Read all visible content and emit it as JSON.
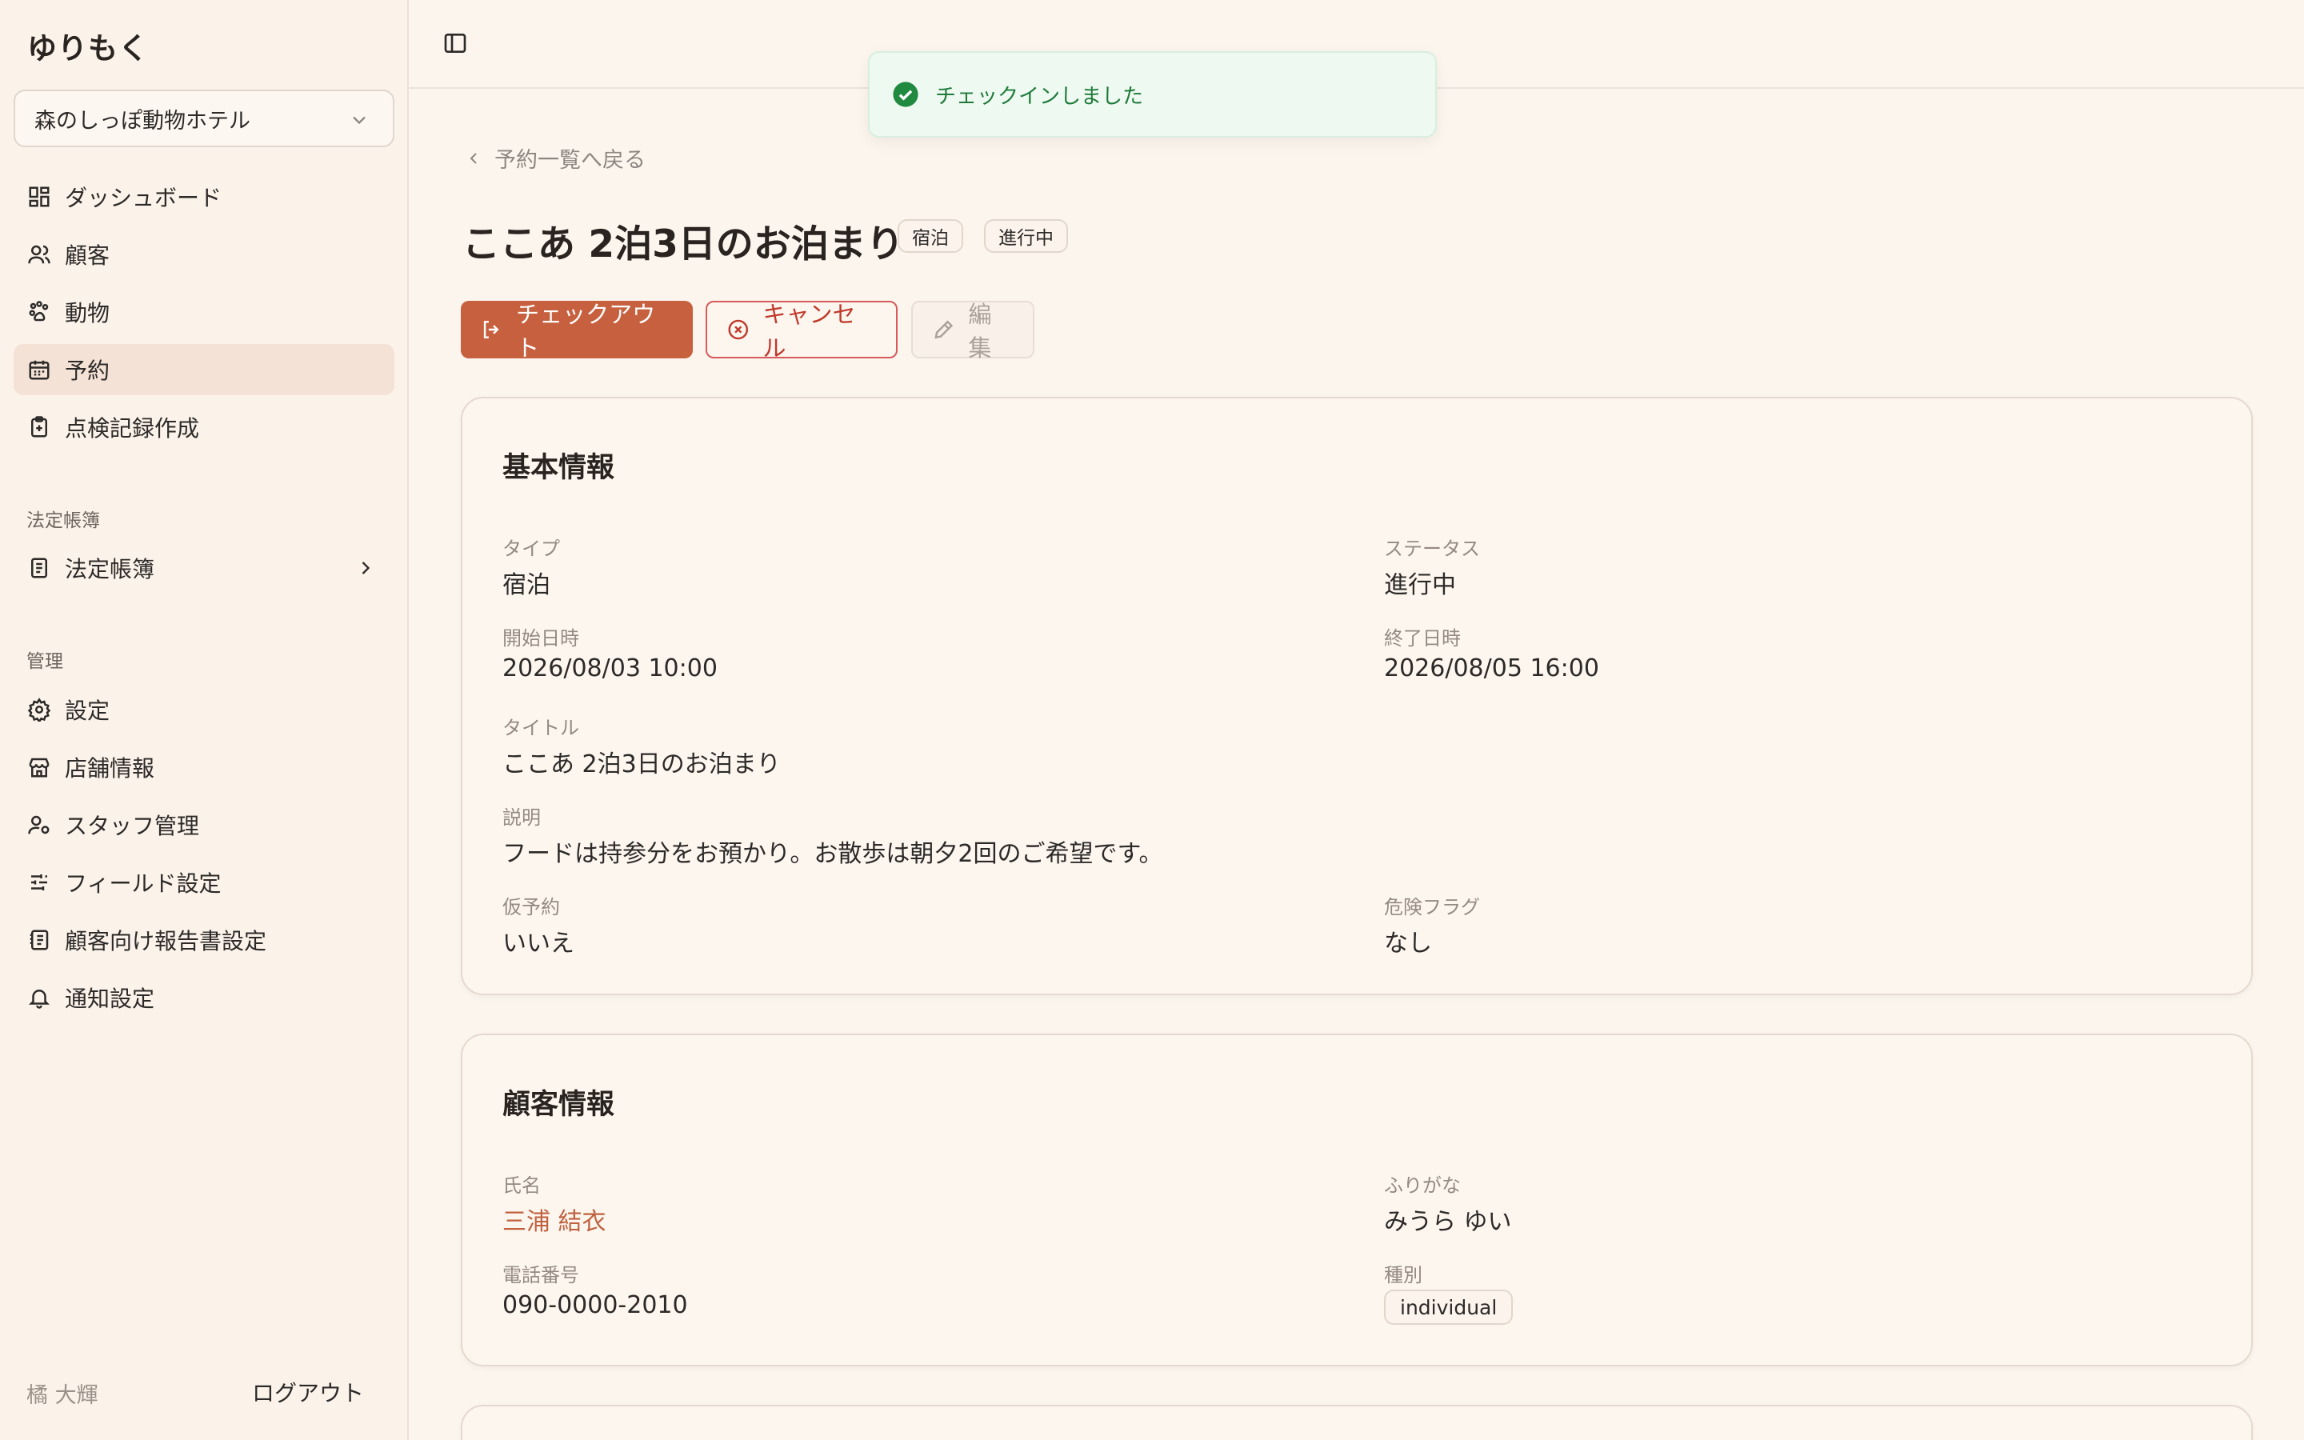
{
  "app": {
    "brand": "ゆりもく",
    "store": "森のしっぽ動物ホテル"
  },
  "sidebar": {
    "main_items": [
      {
        "label": "ダッシュボード",
        "icon": "dashboard-icon"
      },
      {
        "label": "顧客",
        "icon": "users-icon"
      },
      {
        "label": "動物",
        "icon": "paw-icon"
      },
      {
        "label": "予約",
        "icon": "calendar-icon",
        "active": true
      },
      {
        "label": "点検記録作成",
        "icon": "clipboard-icon"
      }
    ],
    "section_legal": "法定帳簿",
    "legal_items": [
      {
        "label": "法定帳簿",
        "icon": "book-icon"
      }
    ],
    "section_admin": "管理",
    "admin_items": [
      {
        "label": "設定",
        "icon": "gear-icon"
      },
      {
        "label": "店舗情報",
        "icon": "store-icon"
      },
      {
        "label": "スタッフ管理",
        "icon": "user-gear-icon"
      },
      {
        "label": "フィールド設定",
        "icon": "sliders-icon"
      },
      {
        "label": "顧客向け報告書設定",
        "icon": "report-icon"
      },
      {
        "label": "通知設定",
        "icon": "bell-icon"
      }
    ],
    "user_name": "橘 大輝",
    "logout": "ログアウト"
  },
  "toast": {
    "message": "チェックインしました"
  },
  "page": {
    "back_link": "予約一覧へ戻る",
    "title": "ここあ 2泊3日のお泊まり",
    "badges": [
      "宿泊",
      "進行中"
    ],
    "actions": {
      "checkout": "チェックアウト",
      "cancel": "キャンセル",
      "edit": "編集"
    }
  },
  "basic_info": {
    "title": "基本情報",
    "type_label": "タイプ",
    "type_value": "宿泊",
    "status_label": "ステータス",
    "status_value": "進行中",
    "start_label": "開始日時",
    "start_value": "2026/08/03 10:00",
    "end_label": "終了日時",
    "end_value": "2026/08/05 16:00",
    "title_label": "タイトル",
    "title_value": "ここあ 2泊3日のお泊まり",
    "desc_label": "説明",
    "desc_value": "フードは持参分をお預かり。お散歩は朝夕2回のご希望です。",
    "tentative_label": "仮予約",
    "tentative_value": "いいえ",
    "danger_label": "危険フラグ",
    "danger_value": "なし"
  },
  "customer_info": {
    "title": "顧客情報",
    "name_label": "氏名",
    "name_value": "三浦 結衣",
    "kana_label": "ふりがな",
    "kana_value": "みうら ゆい",
    "phone_label": "電話番号",
    "phone_value": "090-0000-2010",
    "kind_label": "種別",
    "kind_value": "individual"
  },
  "colors": {
    "accent": "#c7603f",
    "danger": "#c0392b",
    "success": "#1f7a3a",
    "background": "#fcf5ee"
  }
}
